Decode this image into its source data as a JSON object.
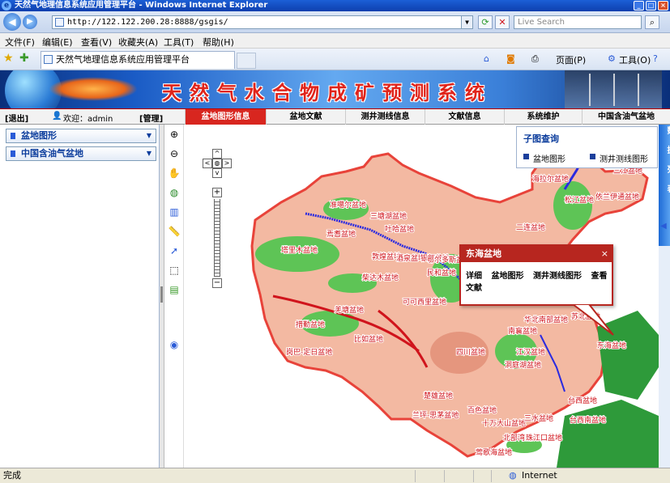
{
  "window": {
    "title": "天然气地理信息系统应用管理平台 - Windows Internet Explorer"
  },
  "browser": {
    "url": "http://122.122.200.28:8888/gsgis/",
    "search_placeholder": "Live Search",
    "menu": [
      "文件(F)",
      "编辑(E)",
      "查看(V)",
      "收藏夹(A)",
      "工具(T)",
      "帮助(H)"
    ],
    "tab_title": "天然气地理信息系统应用管理平台",
    "commands": {
      "page": "页面(P)",
      "tools": "工具(O)"
    }
  },
  "banner": {
    "title": "天然气水合物成矿预测系统"
  },
  "topnav": {
    "exit": "[退出]",
    "welcome": "欢迎：admin",
    "manage": "[管理]",
    "tabs": [
      "盆地图形信息",
      "盆地文献",
      "测井测线信息",
      "文献信息",
      "系统维护",
      "中国含油气盆地"
    ],
    "active_tab": "盆地图形信息"
  },
  "left_panel": {
    "items": [
      "盆地图形",
      "中国含油气盆地"
    ]
  },
  "subquery": {
    "title": "子图查询",
    "links": [
      "盆地图形",
      "测井测线图形"
    ]
  },
  "popup": {
    "title": "东海盆地",
    "close": "×",
    "links": [
      "详细",
      "盆地图形",
      "测井测线图形",
      "查看文献"
    ]
  },
  "side_tab": {
    "label": "数据列表"
  },
  "map": {
    "basins": [
      "海拉尔盆地",
      "二连盆地",
      "松辽盆地",
      "依兰伊通盆地",
      "三江盆地",
      "准噶尔盆地",
      "三塘湖盆地",
      "吐哈盆地",
      "焉耆盆地",
      "塔里木盆地",
      "敦煌盆地",
      "酒泉盆地",
      "银额盆地",
      "鄂尔多斯盆地",
      "民和盆地",
      "可可西里盆地",
      "柴达木盆地",
      "羌塘盆地",
      "措勤盆地",
      "比如盆地",
      "岗巴-定日盆地",
      "华北南部盆地",
      "苏北盆地",
      "南襄盆地",
      "江汉盆地",
      "四川盆地",
      "东海盆地",
      "洞庭湖盆地",
      "楚雄盆地",
      "兰坪-思茅盆地",
      "百色盆地",
      "十万大山盆地",
      "三水盆地",
      "台西盆地",
      "台西南盆地",
      "北部湾盆地",
      "珠江口盆地",
      "莺歌海盆地"
    ]
  },
  "status": {
    "left": "完成",
    "zone": "Internet"
  },
  "colors": {
    "accent_red": "#d8261f",
    "brand_blue": "#0b3c9c"
  }
}
